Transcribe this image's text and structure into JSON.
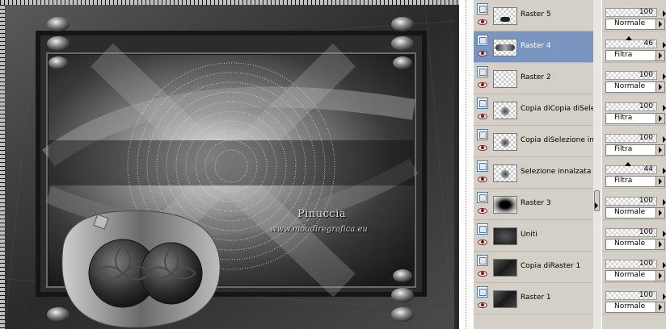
{
  "watermark": {
    "name": "Pinuccia",
    "url": "www.moudiregrafica.eu"
  },
  "layers": [
    {
      "name": "Raster 5",
      "selected": false,
      "opacity": "100",
      "opacity_fraction": 1.0,
      "blend": "Normale",
      "thumb": "raster5"
    },
    {
      "name": "Raster 4",
      "selected": true,
      "opacity": "46",
      "opacity_fraction": 0.46,
      "blend": "Filtra",
      "thumb": "raster4"
    },
    {
      "name": "Raster 2",
      "selected": false,
      "opacity": "100",
      "opacity_fraction": 1.0,
      "blend": "Normale",
      "thumb": "empty"
    },
    {
      "name": "Copia diCopia diSelez",
      "selected": false,
      "opacity": "100",
      "opacity_fraction": 1.0,
      "blend": "Filtra",
      "thumb": "blob"
    },
    {
      "name": "Copia diSelezione innal",
      "selected": false,
      "opacity": "100",
      "opacity_fraction": 1.0,
      "blend": "Filtra",
      "thumb": "blob"
    },
    {
      "name": "Selezione innalzata",
      "selected": false,
      "opacity": "44",
      "opacity_fraction": 0.44,
      "blend": "Filtra",
      "thumb": "blob"
    },
    {
      "name": "Raster 3",
      "selected": false,
      "opacity": "100",
      "opacity_fraction": 1.0,
      "blend": "Normale",
      "thumb": "raster3"
    },
    {
      "name": "Uniti",
      "selected": false,
      "opacity": "100",
      "opacity_fraction": 1.0,
      "blend": "Normale",
      "thumb": "dark"
    },
    {
      "name": "Copia diRaster 1",
      "selected": false,
      "opacity": "100",
      "opacity_fraction": 1.0,
      "blend": "Normale",
      "thumb": "darkgrad"
    },
    {
      "name": "Raster 1",
      "selected": false,
      "opacity": "100",
      "opacity_fraction": 1.0,
      "blend": "Normale",
      "thumb": "darkgrad"
    }
  ]
}
